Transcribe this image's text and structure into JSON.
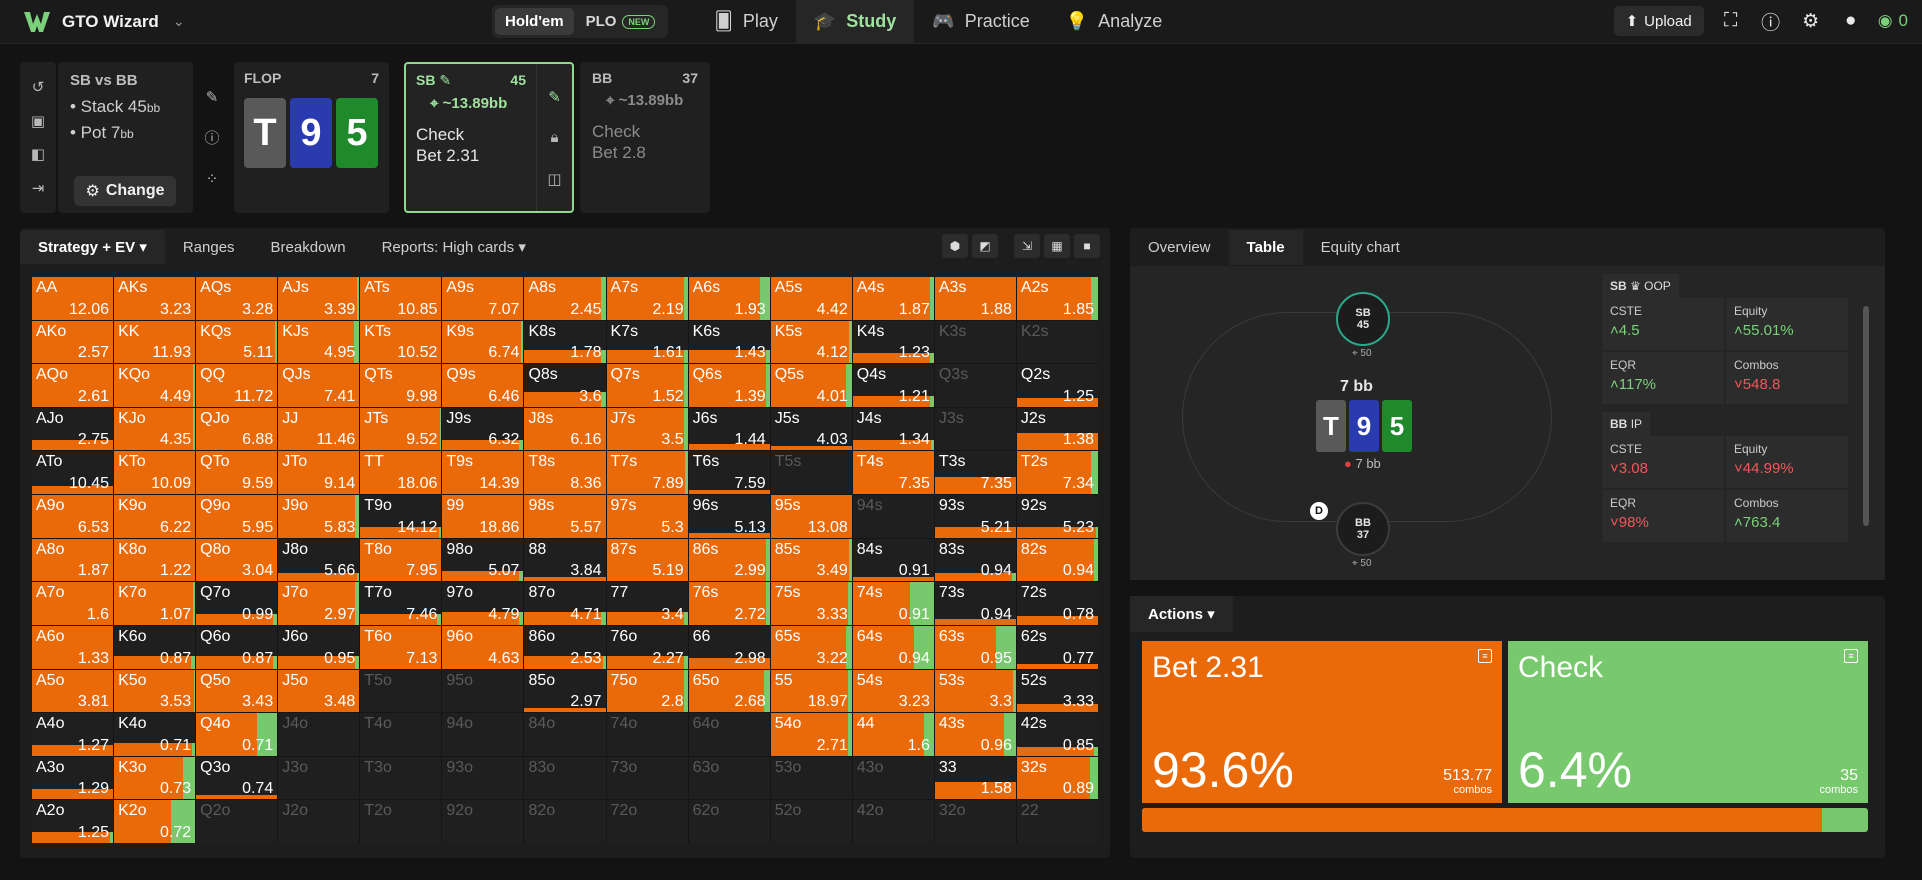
{
  "topbar": {
    "brand": "GTO Wizard",
    "gametypes": [
      {
        "label": "Hold'em",
        "active": true
      },
      {
        "label": "PLO",
        "badge": "NEW"
      }
    ],
    "nav": [
      {
        "label": "Play",
        "icon": "cards-icon"
      },
      {
        "label": "Study",
        "icon": "graduation-cap-icon",
        "active": true
      },
      {
        "label": "Practice",
        "icon": "gamepad-icon"
      },
      {
        "label": "Analyze",
        "icon": "lightbulb-icon"
      }
    ],
    "upload": "Upload",
    "credits": "0"
  },
  "spot": {
    "title": "SB vs BB",
    "stack_prefix": "• Stack 45",
    "pot_prefix": "• Pot 7",
    "unit": "bb",
    "change": "Change"
  },
  "flop": {
    "label": "FLOP",
    "count": "7",
    "cards": [
      "T",
      "9",
      "5"
    ]
  },
  "players": {
    "sb": {
      "label": "SB",
      "stack": "45",
      "ev": "~13.89bb",
      "actions": [
        "Check",
        "Bet 2.31"
      ]
    },
    "bb": {
      "label": "BB",
      "stack": "37",
      "ev": "~13.89bb",
      "actions": [
        "Check",
        "Bet 2.8"
      ]
    }
  },
  "left_tabs": [
    "Strategy + EV",
    "Ranges",
    "Breakdown",
    "Reports: High cards"
  ],
  "right_tabs": [
    "Overview",
    "Table",
    "Equity chart"
  ],
  "colors": {
    "bet": "#ea6a0a",
    "check": "#78c96d",
    "empty": "#1f1f1f"
  },
  "matrix": [
    [
      [
        "AA",
        "12.06",
        1,
        0
      ],
      [
        "AKs",
        "3.23",
        1,
        0
      ],
      [
        "AQs",
        "3.28",
        1,
        0
      ],
      [
        "AJs",
        "3.39",
        1,
        0.03
      ],
      [
        "ATs",
        "10.85",
        1,
        0
      ],
      [
        "A9s",
        "7.07",
        1,
        0
      ],
      [
        "A8s",
        "2.45",
        1,
        0.05
      ],
      [
        "A7s",
        "2.19",
        1,
        0.05
      ],
      [
        "A6s",
        "1.93",
        1,
        0.12
      ],
      [
        "A5s",
        "4.42",
        1,
        0
      ],
      [
        "A4s",
        "1.87",
        1,
        0.05
      ],
      [
        "A3s",
        "1.88",
        1,
        0
      ],
      [
        "A2s",
        "1.85",
        1,
        0.08
      ]
    ],
    [
      [
        "AKo",
        "2.57",
        1,
        0
      ],
      [
        "KK",
        "11.93",
        1,
        0
      ],
      [
        "KQs",
        "5.11",
        1,
        0.03
      ],
      [
        "KJs",
        "4.95",
        1,
        0.07
      ],
      [
        "KTs",
        "10.52",
        1,
        0
      ],
      [
        "K9s",
        "6.74",
        1,
        0.03
      ],
      [
        "K8s",
        "1.78",
        0.3,
        0.05
      ],
      [
        "K7s",
        "1.61",
        0.3,
        0.05
      ],
      [
        "K6s",
        "1.43",
        0.3,
        0.05
      ],
      [
        "K5s",
        "4.12",
        1,
        0.03
      ],
      [
        "K4s",
        "1.23",
        0.25,
        0.05
      ],
      [
        "K3s",
        "",
        0,
        0
      ],
      [
        "K2s",
        "",
        0,
        0
      ]
    ],
    [
      [
        "AQo",
        "2.61",
        1,
        0
      ],
      [
        "KQo",
        "4.49",
        1,
        0.03
      ],
      [
        "QQ",
        "11.72",
        1,
        0
      ],
      [
        "QJs",
        "7.41",
        1,
        0
      ],
      [
        "QTs",
        "9.98",
        1,
        0
      ],
      [
        "Q9s",
        "6.46",
        1,
        0
      ],
      [
        "Q8s",
        "3.6",
        0.35,
        0.05
      ],
      [
        "Q7s",
        "1.52",
        1,
        0.05
      ],
      [
        "Q6s",
        "1.39",
        1,
        0.05
      ],
      [
        "Q5s",
        "4.01",
        1,
        0.07
      ],
      [
        "Q4s",
        "1.21",
        0.25,
        0.05
      ],
      [
        "Q3s",
        "",
        0,
        0
      ],
      [
        "Q2s",
        "1.25",
        0.2,
        0
      ]
    ],
    [
      [
        "AJo",
        "2.75",
        0.25,
        0
      ],
      [
        "KJo",
        "4.35",
        1,
        0.03
      ],
      [
        "QJo",
        "6.88",
        1,
        0
      ],
      [
        "JJ",
        "11.46",
        1,
        0
      ],
      [
        "JTs",
        "9.52",
        1,
        0.02
      ],
      [
        "J9s",
        "6.32",
        0.25,
        0.05
      ],
      [
        "J8s",
        "6.16",
        1,
        0
      ],
      [
        "J7s",
        "3.5",
        1,
        0.04
      ],
      [
        "J6s",
        "1.44",
        0.15,
        0
      ],
      [
        "J5s",
        "4.03",
        0.1,
        0
      ],
      [
        "J4s",
        "1.34",
        0.25,
        0.03
      ],
      [
        "J3s",
        "",
        0,
        0
      ],
      [
        "J2s",
        "1.38",
        0.4,
        0
      ]
    ],
    [
      [
        "ATo",
        "10.45",
        0.2,
        0
      ],
      [
        "KTo",
        "10.09",
        1,
        0
      ],
      [
        "QTo",
        "9.59",
        1,
        0
      ],
      [
        "JTo",
        "9.14",
        1,
        0
      ],
      [
        "TT",
        "18.06",
        1,
        0
      ],
      [
        "T9s",
        "14.39",
        1,
        0
      ],
      [
        "T8s",
        "8.36",
        1,
        0
      ],
      [
        "T7s",
        "7.89",
        1,
        0.03
      ],
      [
        "T6s",
        "7.59",
        0.1,
        0
      ],
      [
        "T5s",
        "",
        0,
        0
      ],
      [
        "T4s",
        "7.35",
        1,
        0
      ],
      [
        "T3s",
        "7.35",
        0.4,
        0
      ],
      [
        "T2s",
        "7.34",
        1,
        0.08
      ]
    ],
    [
      [
        "A9o",
        "6.53",
        1,
        0
      ],
      [
        "K9o",
        "6.22",
        1,
        0
      ],
      [
        "Q9o",
        "5.95",
        1,
        0
      ],
      [
        "J9o",
        "5.83",
        1,
        0.05
      ],
      [
        "T9o",
        "14.12",
        0.25,
        0.03
      ],
      [
        "99",
        "18.86",
        1,
        0
      ],
      [
        "98s",
        "5.57",
        1,
        0
      ],
      [
        "97s",
        "5.3",
        1,
        0
      ],
      [
        "96s",
        "5.13",
        0.1,
        0
      ],
      [
        "95s",
        "13.08",
        1,
        0
      ],
      [
        "94s",
        "",
        0,
        0
      ],
      [
        "93s",
        "5.21",
        0.25,
        0
      ],
      [
        "92s",
        "5.23",
        0.25,
        0.03
      ]
    ],
    [
      [
        "A8o",
        "1.87",
        1,
        0
      ],
      [
        "K8o",
        "1.22",
        1,
        0
      ],
      [
        "Q8o",
        "3.04",
        1,
        0
      ],
      [
        "J8o",
        "5.66",
        0.2,
        0.03
      ],
      [
        "T8o",
        "7.95",
        1,
        0
      ],
      [
        "98o",
        "5.07",
        0.25,
        0.05
      ],
      [
        "88",
        "3.84",
        0.1,
        0
      ],
      [
        "87s",
        "5.19",
        1,
        0
      ],
      [
        "86s",
        "2.99",
        1,
        0.05
      ],
      [
        "85s",
        "3.49",
        1,
        0.04
      ],
      [
        "84s",
        "0.91",
        0.1,
        0
      ],
      [
        "83s",
        "0.94",
        0.2,
        0.05
      ],
      [
        "82s",
        "0.94",
        1,
        0.05
      ]
    ],
    [
      [
        "A7o",
        "1.6",
        1,
        0
      ],
      [
        "K7o",
        "1.07",
        1,
        0.03
      ],
      [
        "Q7o",
        "0.99",
        0.25,
        0.05
      ],
      [
        "J7o",
        "2.97",
        1,
        0.05
      ],
      [
        "T7o",
        "7.46",
        0.25,
        0.05
      ],
      [
        "97o",
        "4.79",
        0.3,
        0.05
      ],
      [
        "87o",
        "4.71",
        0.3,
        0.05
      ],
      [
        "77",
        "3.4",
        0.3,
        0.05
      ],
      [
        "76s",
        "2.72",
        1,
        0.04
      ],
      [
        "75s",
        "3.33",
        1,
        0.05
      ],
      [
        "74s",
        "0.91",
        1,
        0.3
      ],
      [
        "73s",
        "0.94",
        0.15,
        0
      ],
      [
        "72s",
        "0.78",
        0.2,
        0
      ]
    ],
    [
      [
        "A6o",
        "1.33",
        1,
        0
      ],
      [
        "K6o",
        "0.87",
        0.3,
        0.05
      ],
      [
        "Q6o",
        "0.87",
        0.3,
        0.05
      ],
      [
        "J6o",
        "0.95",
        0.3,
        0.05
      ],
      [
        "T6o",
        "7.13",
        1,
        0
      ],
      [
        "96o",
        "4.63",
        1,
        0
      ],
      [
        "86o",
        "2.53",
        0.3,
        0.03
      ],
      [
        "76o",
        "2.27",
        0.3,
        0.05
      ],
      [
        "66",
        "2.98",
        0.25,
        0
      ],
      [
        "65s",
        "3.22",
        1,
        0.07
      ],
      [
        "64s",
        "0.94",
        1,
        0.25
      ],
      [
        "63s",
        "0.95",
        1,
        0.25
      ],
      [
        "62s",
        "0.77",
        0.1,
        0
      ]
    ],
    [
      [
        "A5o",
        "3.81",
        1,
        0
      ],
      [
        "K5o",
        "3.53",
        1,
        0.02
      ],
      [
        "Q5o",
        "3.43",
        1,
        0
      ],
      [
        "J5o",
        "3.48",
        1,
        0
      ],
      [
        "T5o",
        "",
        0,
        0
      ],
      [
        "95o",
        "",
        0,
        0
      ],
      [
        "85o",
        "2.97",
        0.1,
        0
      ],
      [
        "75o",
        "2.8",
        1,
        0.04
      ],
      [
        "65o",
        "2.68",
        1,
        0.07
      ],
      [
        "55",
        "18.97",
        1,
        0.05
      ],
      [
        "54s",
        "3.23",
        1,
        0
      ],
      [
        "53s",
        "3.3",
        1,
        0.04
      ],
      [
        "52s",
        "3.33",
        0.2,
        0
      ]
    ],
    [
      [
        "A4o",
        "1.27",
        0.25,
        0
      ],
      [
        "K4o",
        "0.71",
        0.3,
        0.04
      ],
      [
        "Q4o",
        "0.71",
        1,
        0.25
      ],
      [
        "J4o",
        "",
        0,
        0
      ],
      [
        "T4o",
        "",
        0,
        0
      ],
      [
        "94o",
        "",
        0,
        0
      ],
      [
        "84o",
        "",
        0,
        0
      ],
      [
        "74o",
        "",
        0,
        0
      ],
      [
        "64o",
        "",
        0,
        0
      ],
      [
        "54o",
        "2.71",
        1,
        0.05
      ],
      [
        "44",
        "1.6",
        1,
        0.12
      ],
      [
        "43s",
        "0.96",
        1,
        0.15
      ],
      [
        "42s",
        "0.85",
        0.2,
        0.05
      ]
    ],
    [
      [
        "A3o",
        "1.29",
        0.25,
        0
      ],
      [
        "K3o",
        "0.73",
        1,
        0.15
      ],
      [
        "Q3o",
        "0.74",
        0.1,
        0
      ],
      [
        "J3o",
        "",
        0,
        0
      ],
      [
        "T3o",
        "",
        0,
        0
      ],
      [
        "93o",
        "",
        0,
        0
      ],
      [
        "83o",
        "",
        0,
        0
      ],
      [
        "73o",
        "",
        0,
        0
      ],
      [
        "63o",
        "",
        0,
        0
      ],
      [
        "53o",
        "",
        0,
        0
      ],
      [
        "43o",
        "",
        0,
        0
      ],
      [
        "33",
        "1.58",
        0.4,
        0
      ],
      [
        "32s",
        "0.89",
        1,
        0.1
      ]
    ],
    [
      [
        "A2o",
        "1.25",
        0.25,
        0.04
      ],
      [
        "K2o",
        "0.72",
        1,
        0.3
      ],
      [
        "Q2o",
        "",
        0,
        0
      ],
      [
        "J2o",
        "",
        0,
        0
      ],
      [
        "T2o",
        "",
        0,
        0
      ],
      [
        "92o",
        "",
        0,
        0
      ],
      [
        "82o",
        "",
        0,
        0
      ],
      [
        "72o",
        "",
        0,
        0
      ],
      [
        "62o",
        "",
        0,
        0
      ],
      [
        "52o",
        "",
        0,
        0
      ],
      [
        "42o",
        "",
        0,
        0
      ],
      [
        "32o",
        "",
        0,
        0
      ],
      [
        "22",
        "",
        0,
        0
      ]
    ]
  ],
  "table": {
    "sb_seat": {
      "label": "SB",
      "stack": "45",
      "chips": "50"
    },
    "bb_seat": {
      "label": "BB",
      "stack": "37",
      "chips": "50"
    },
    "pot": "7 bb",
    "pot_chips": "7 bb",
    "dealer": "D",
    "cards": [
      "T",
      "9",
      "5"
    ]
  },
  "stats": {
    "sb": {
      "header": "SB",
      "position": "OOP",
      "items": [
        {
          "label": "CSTE",
          "value": "4.5",
          "dir": "pos"
        },
        {
          "label": "Equity",
          "value": "55.01%",
          "dir": "pos"
        },
        {
          "label": "EQR",
          "value": "117%",
          "dir": "pos"
        },
        {
          "label": "Combos",
          "value": "548.8",
          "dir": "neg"
        }
      ]
    },
    "bb": {
      "header": "BB",
      "position": "IP",
      "items": [
        {
          "label": "CSTE",
          "value": "3.08",
          "dir": "neg"
        },
        {
          "label": "Equity",
          "value": "44.99%",
          "dir": "neg"
        },
        {
          "label": "EQR",
          "value": "98%",
          "dir": "neg"
        },
        {
          "label": "Combos",
          "value": "763.4",
          "dir": "pos"
        }
      ]
    }
  },
  "actions": {
    "tab": "Actions",
    "bet": {
      "label": "Bet 2.31",
      "pct": "93.6%",
      "combos": "513.77",
      "combos_unit": "combos",
      "frequency": 0.936
    },
    "check": {
      "label": "Check",
      "pct": "6.4%",
      "combos": "35",
      "combos_unit": "combos"
    }
  }
}
